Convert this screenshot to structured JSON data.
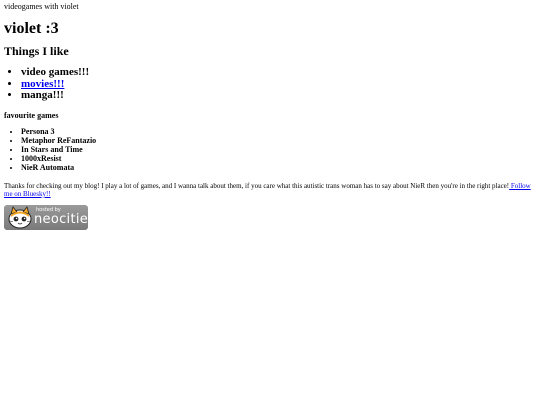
{
  "site": {
    "title": "videogames with violet"
  },
  "header": {
    "heading": "violet :3",
    "subheading": "Things I like"
  },
  "likes": [
    {
      "label": "video games!!!"
    },
    {
      "label": "movies!!!"
    },
    {
      "label": "manga!!!"
    }
  ],
  "favourites": {
    "heading": "favourite games",
    "games": [
      "Persona 3",
      "Metaphor ReFantazio",
      "In Stars and Time",
      "1000xResist",
      "NieR Automata"
    ]
  },
  "blurb": {
    "text": "Thanks for checking out my blog! I play a lot of games, and I wanna talk about them, if you care what this autistic trans woman has to say about NieR then you're in the right place!",
    "link_label": " Follow me on Bluesky!!"
  },
  "badge": {
    "small": "hosted by",
    "big": "neocities"
  },
  "colors": {
    "link": "#0000ee",
    "badge_bg": "#8a8a8a",
    "cat": "#f5a623"
  }
}
